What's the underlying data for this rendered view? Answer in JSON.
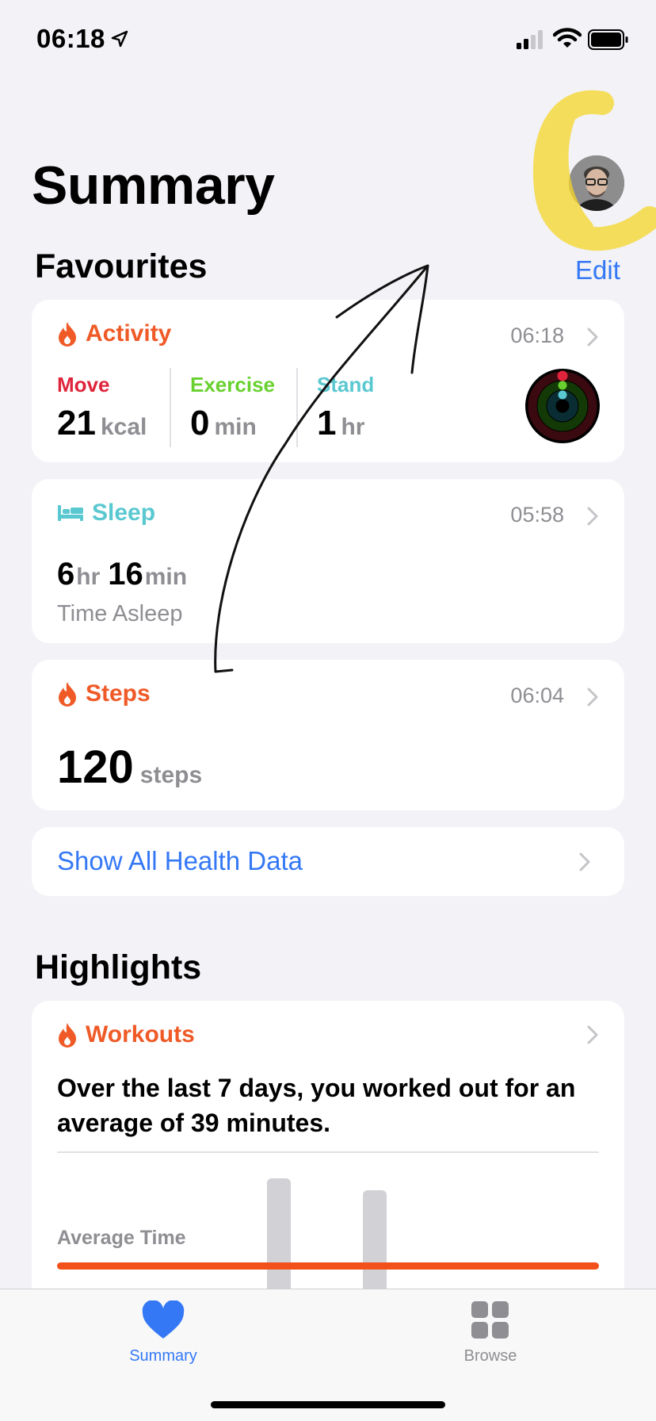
{
  "status_bar": {
    "time": "06:18"
  },
  "header": {
    "title": "Summary"
  },
  "favourites": {
    "title": "Favourites",
    "edit_label": "Edit",
    "activity": {
      "title": "Activity",
      "time": "06:18",
      "move": {
        "label": "Move",
        "value": "21",
        "unit": "kcal"
      },
      "exercise": {
        "label": "Exercise",
        "value": "0",
        "unit": "min"
      },
      "stand": {
        "label": "Stand",
        "value": "1",
        "unit": "hr"
      }
    },
    "sleep": {
      "title": "Sleep",
      "time": "05:58",
      "hours": "6",
      "hours_unit": "hr",
      "minutes": "16",
      "minutes_unit": "min",
      "caption": "Time Asleep"
    },
    "steps": {
      "title": "Steps",
      "time": "06:04",
      "value": "120",
      "unit": "steps"
    },
    "show_all_label": "Show All Health Data"
  },
  "highlights": {
    "title": "Highlights",
    "workouts": {
      "title": "Workouts",
      "text": "Over the last 7 days, you worked out for an average of 39 minutes.",
      "avg_label": "Average Time"
    }
  },
  "tab_bar": {
    "tabs": [
      {
        "label": "Summary",
        "active": true
      },
      {
        "label": "Browse",
        "active": false
      }
    ]
  },
  "colors": {
    "accent": "#3478f6",
    "orange": "#ef5a27",
    "move": "#e0243b",
    "exercise": "#68d12f",
    "stand": "#5ac8d0",
    "sleep": "#5ac8d0"
  }
}
